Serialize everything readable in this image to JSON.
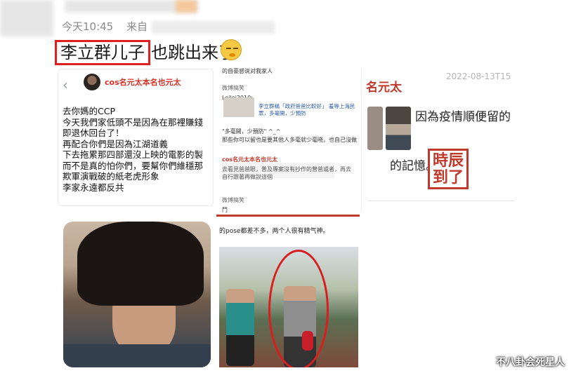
{
  "header": {
    "time": "今天10:45",
    "source_prefix": "来自"
  },
  "post": {
    "highlight_text": "李立群儿子",
    "rest_text": "也跳出来了",
    "emoji": "smirking-face"
  },
  "card1": {
    "back_icon": "‹",
    "username": "cos名元太本名也元太",
    "lines": [
      "去你媽的CCP",
      "今天我們家低頭不是因為在那裡賺錢",
      "即退休回台了！",
      "再配合你們是因為江湖道義",
      "下去拖累那四部還沒上映的電影的製",
      "而不是真的怕你們，要幫你們維穩那",
      "欺軍演戰破的紙老虎形象",
      "李家永遠都反共"
    ]
  },
  "card2": {
    "top_line": "的自豪感说对我家人",
    "tag1": "微博搞笑",
    "commenter": "Leilei2010:",
    "blue_text": "李立群稱「政府爸爸比較好」 羞辱上海民眾，多毫開，少預防",
    "quote": "\"多毫開，少預防\" ^_^",
    "body": "那些你可以留也是要其他人多毫就少毫晓，也自己沒做",
    "name2": "cos名元太本名也元太",
    "reply": "去看見爸爸眼，普及專案沒有抄作的曾爸或者，再去自行跟著再做說這個",
    "tag2": "微博搞笑",
    "mark": "鬥"
  },
  "card3": {
    "name": "名元太",
    "date": "2022-08-13T15",
    "text1": "因為疫情順便留的",
    "text2": "的記憶。",
    "stamp": "時辰到了"
  },
  "photo2": {
    "caption": "的pose都差不多，两个人很有精气神。"
  },
  "watermark": "不八卦会死星人",
  "colors": {
    "highlight_border": "#e02020",
    "username_red": "#d93025",
    "stamp_red": "#c0392b"
  }
}
